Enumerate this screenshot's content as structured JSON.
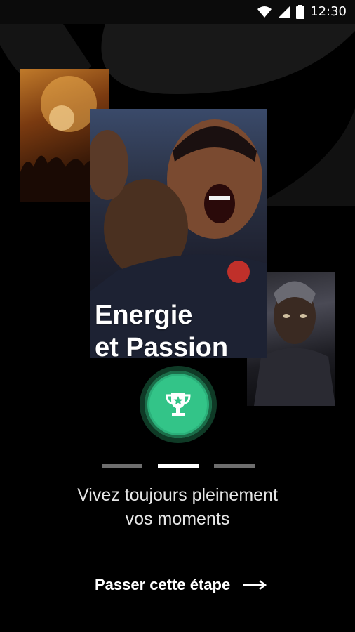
{
  "status_bar": {
    "time": "12:30"
  },
  "onboarding": {
    "headline_line1": "Energie",
    "headline_line2": "et Passion",
    "tagline_line1": "Vivez toujours pleinement",
    "tagline_line2": "vos moments",
    "pager": {
      "count": 3,
      "active_index": 1
    },
    "skip_label": "Passer cette étape"
  },
  "colors": {
    "background": "#000000",
    "accent_green": "#33c488",
    "pager_inactive": "#6e6e6e",
    "pager_active": "#ffffff"
  },
  "icons": {
    "wifi": "wifi-icon",
    "signal": "signal-icon",
    "battery": "battery-icon",
    "trophy": "trophy-icon",
    "arrow": "arrow-right-icon"
  }
}
